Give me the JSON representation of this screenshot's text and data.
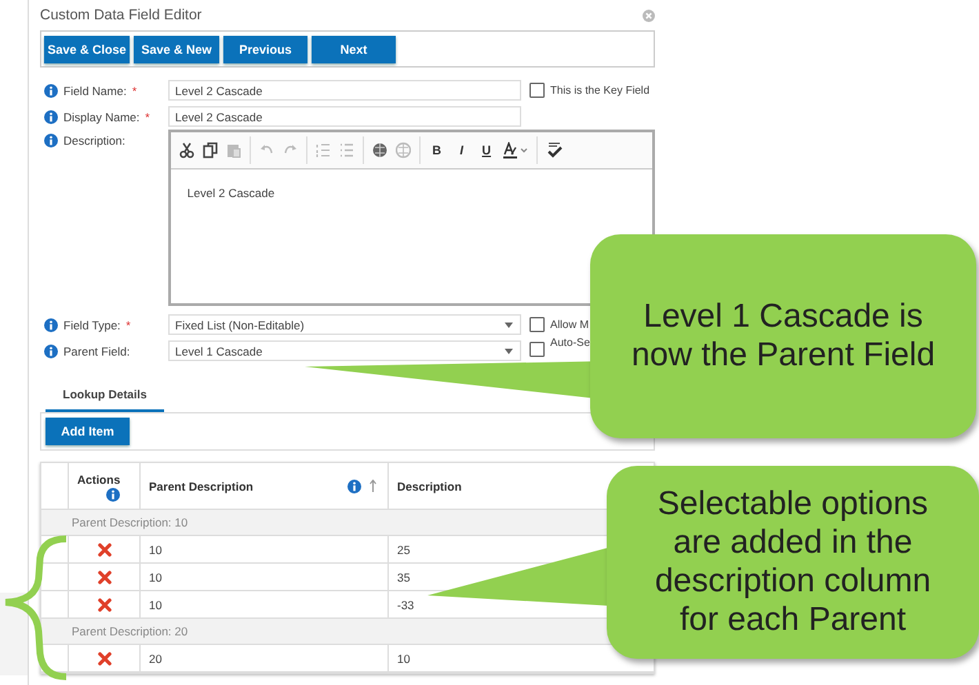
{
  "dialog": {
    "title": "Custom Data Field Editor"
  },
  "toolbar_buttons": [
    "Save & Close",
    "Save & New",
    "Previous",
    "Next"
  ],
  "fields": [
    {
      "label": "Field Name:",
      "required_mark": "*",
      "kind": "text",
      "value": "Level 2 Cascade",
      "checkbox": {
        "label": "This is the Key Field",
        "checked": false
      }
    },
    {
      "label": "Display Name:",
      "required_mark": "*",
      "kind": "text",
      "value": "Level 2 Cascade"
    },
    {
      "label": "Description:",
      "kind": "editor",
      "value": "Level 2 Cascade",
      "format_buttons": [
        "B",
        "I",
        "U"
      ]
    },
    {
      "label": "Field Type:",
      "required_mark": "*",
      "kind": "select",
      "value": "Fixed List (Non-Editable)",
      "checkbox": {
        "label": "Allow M",
        "checked": false
      }
    },
    {
      "label": "Parent Field:",
      "kind": "select",
      "value": "Level 1 Cascade",
      "checkbox": {
        "label": "Auto-Se",
        "checked": false
      }
    }
  ],
  "tabs": [
    {
      "label": "Lookup Details",
      "selected": true
    }
  ],
  "add_button": "Add Item",
  "table": {
    "columns": [
      "Actions",
      "Parent Description",
      "Description"
    ],
    "groups": [
      {
        "label": "Parent Description: 10",
        "rows": [
          [
            "10",
            "25"
          ],
          [
            "10",
            "35"
          ],
          [
            "10",
            "-33"
          ]
        ]
      },
      {
        "label": "Parent Description: 20",
        "rows": [
          [
            "20",
            "10"
          ]
        ]
      }
    ]
  },
  "callouts": [
    {
      "text": "Level 1 Cascade is now the Parent Field"
    },
    {
      "text": "Selectable options are added in the description column for each Parent"
    }
  ]
}
